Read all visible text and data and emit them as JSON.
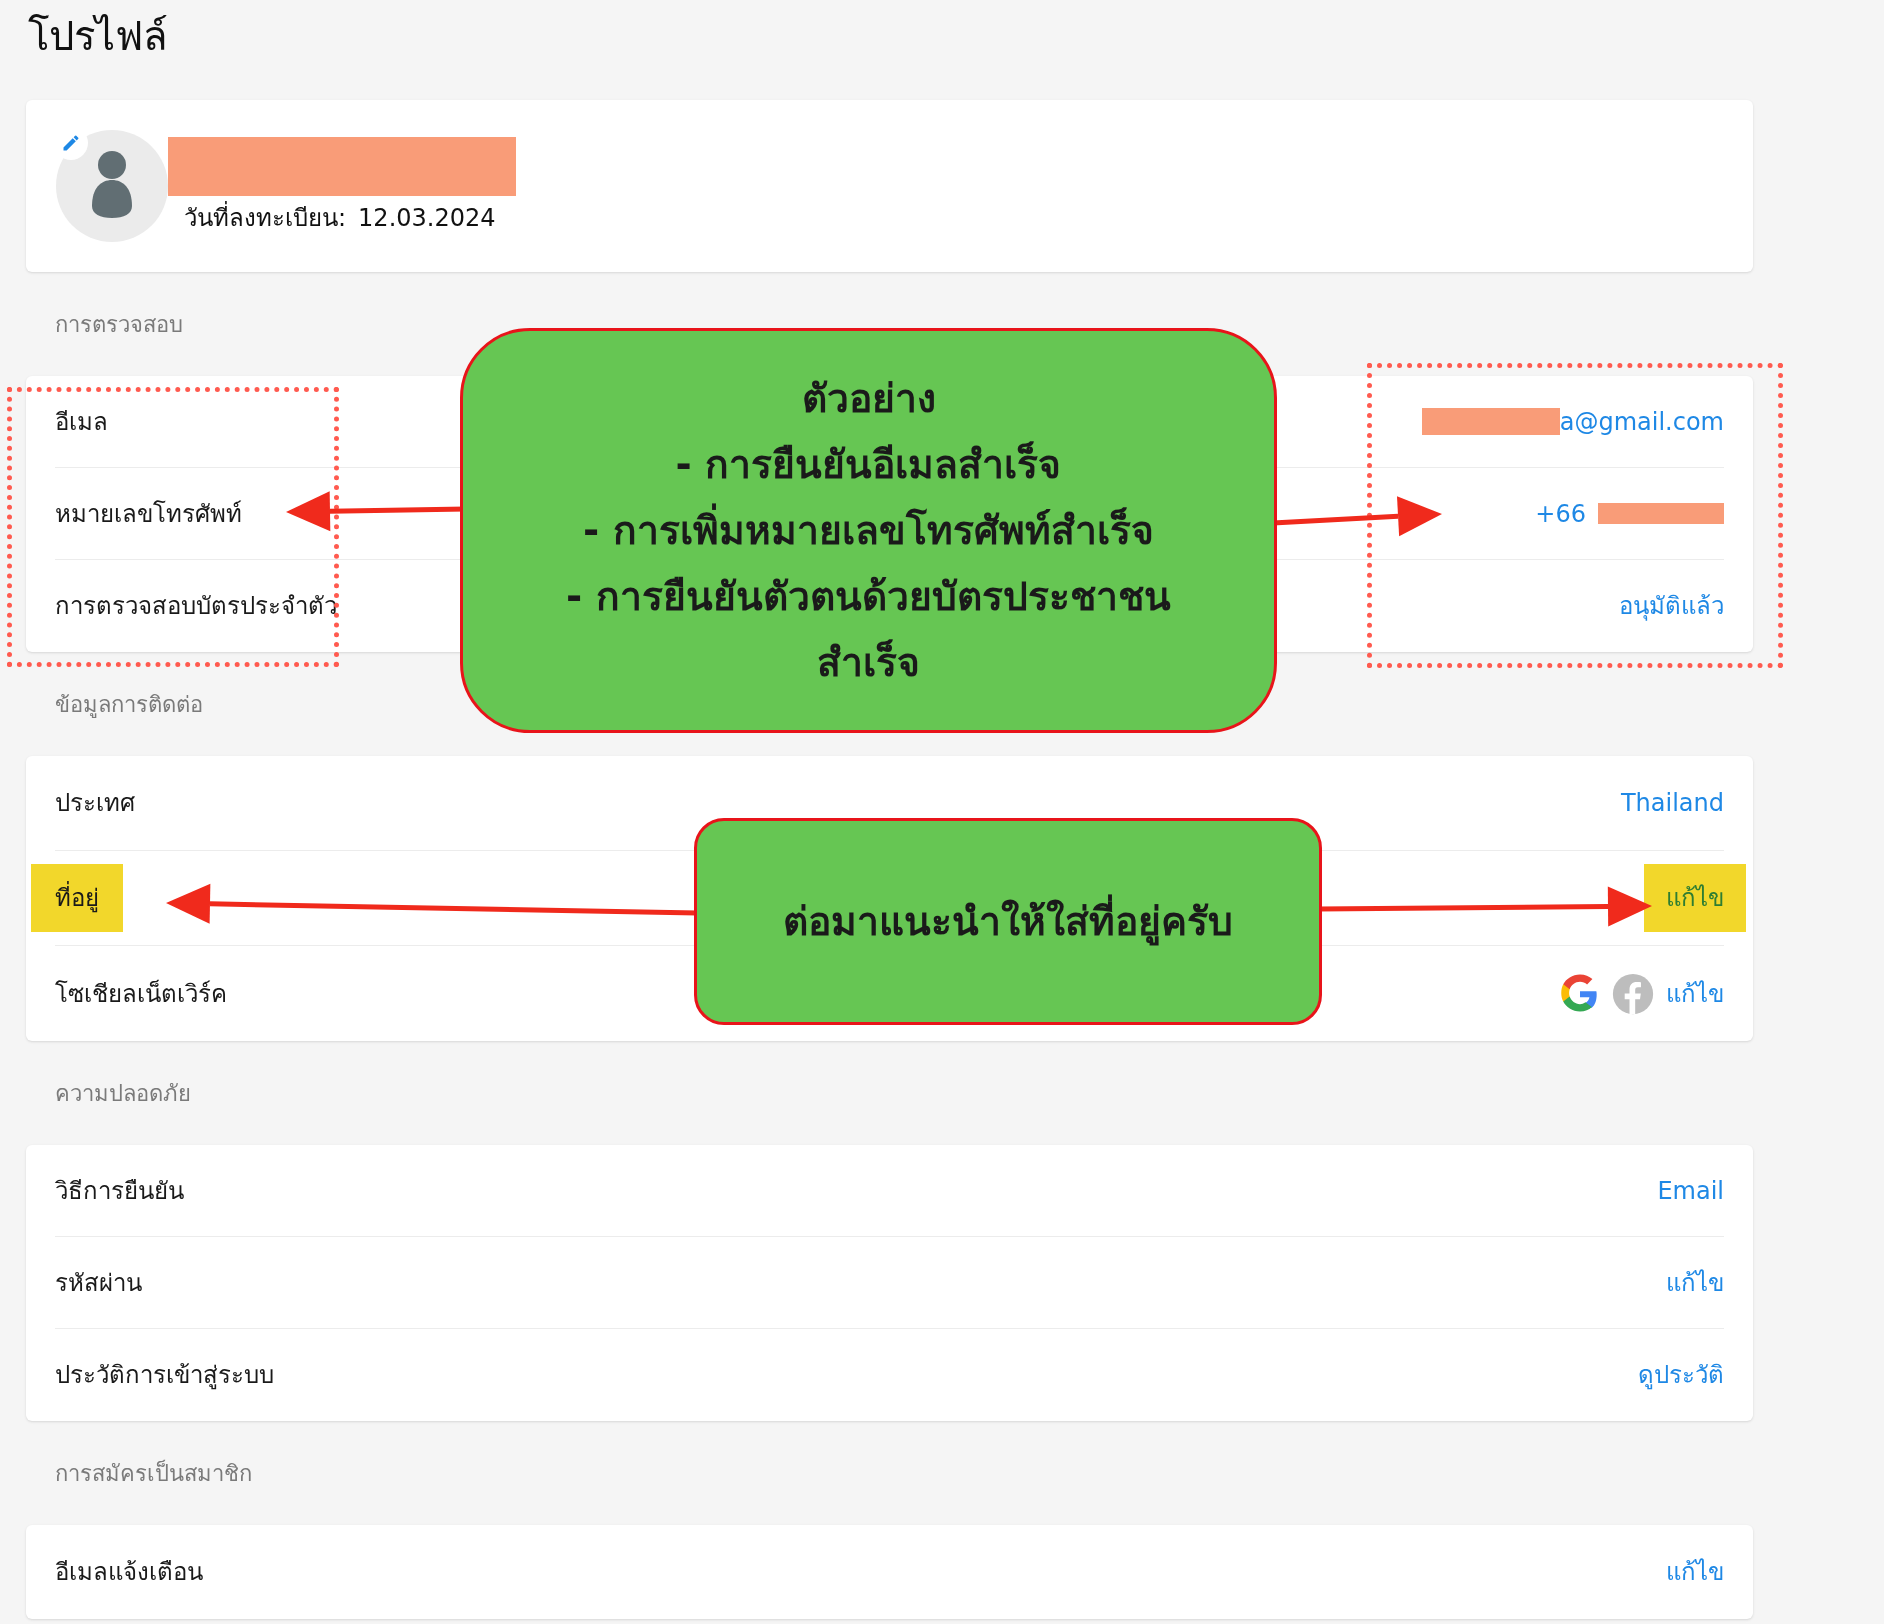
{
  "page_title": "โปรไฟล์",
  "profile": {
    "name_redacted": true,
    "registered_label": "วันที่ลงทะเบียน:",
    "registered_date": "12.03.2024"
  },
  "sections": [
    {
      "title": "การตรวจสอบ",
      "rows": [
        {
          "kind": "text",
          "label": "อีเมล",
          "value": "a@gmail.com",
          "redacted_before": true,
          "label_highlighted": false,
          "value_highlighted": false
        },
        {
          "kind": "text",
          "label": "หมายเลขโทรศัพท์",
          "value": "+66",
          "redacted_after": true,
          "label_highlighted": false,
          "value_highlighted": false
        },
        {
          "kind": "text",
          "label": "การตรวจสอบบัตรประจำตัว",
          "value": "อนุมัติแล้ว",
          "label_highlighted": false,
          "value_highlighted": false
        }
      ]
    },
    {
      "title": "ข้อมูลการติดต่อ",
      "rows": [
        {
          "kind": "text",
          "label": "ประเทศ",
          "value": "Thailand",
          "label_highlighted": false,
          "value_highlighted": false
        },
        {
          "kind": "text",
          "label": "ที่อยู่",
          "value": "แก้ไข",
          "label_highlighted": true,
          "value_highlighted": true
        },
        {
          "kind": "social",
          "label": "โซเชียลเน็ตเวิร์ค",
          "value": "แก้ไข",
          "label_highlighted": false,
          "value_highlighted": false
        }
      ]
    },
    {
      "title": "ความปลอดภัย",
      "rows": [
        {
          "kind": "text",
          "label": "วิธีการยืนยัน",
          "value": "Email",
          "label_highlighted": false,
          "value_highlighted": false
        },
        {
          "kind": "text",
          "label": "รหัสผ่าน",
          "value": "แก้ไข",
          "label_highlighted": false,
          "value_highlighted": false
        },
        {
          "kind": "text",
          "label": "ประวัติการเข้าสู่ระบบ",
          "value": "ดูประวัติ",
          "label_highlighted": false,
          "value_highlighted": false
        }
      ]
    },
    {
      "title": "การสมัครเป็นสมาชิก",
      "rows": [
        {
          "kind": "text",
          "label": "อีเมลแจ้งเตือน",
          "value": "แก้ไข",
          "label_highlighted": false,
          "value_highlighted": false
        }
      ]
    }
  ],
  "callouts": [
    {
      "lines": [
        "ตัวอย่าง",
        "- การยืนยันอีเมลสำเร็จ",
        "- การเพิ่มหมายเลขโทรศัพท์สำเร็จ",
        "- การยืนยันตัวตนด้วยบัตรประชาชนสำเร็จ"
      ]
    },
    {
      "lines": [
        "ต่อมาแนะนำให้ใส่ที่อยู่ครับ"
      ]
    }
  ]
}
